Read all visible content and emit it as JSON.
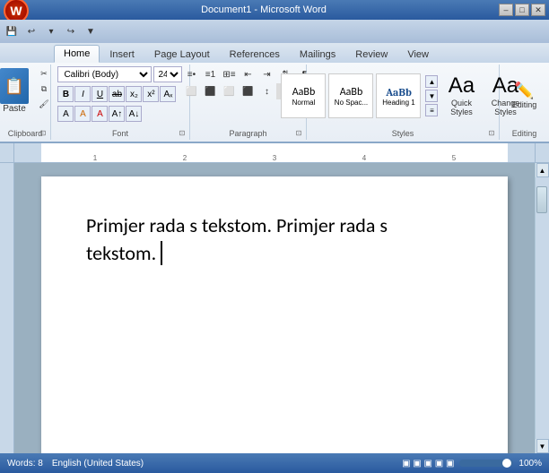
{
  "titlebar": {
    "title": "Document1 - Microsoft Word",
    "minimize": "–",
    "restore": "□",
    "close": "✕"
  },
  "quickaccess": {
    "save": "💾",
    "undo": "↩",
    "redo": "↪",
    "dropdown": "▼"
  },
  "tabs": [
    {
      "id": "home",
      "label": "Home",
      "active": true
    },
    {
      "id": "insert",
      "label": "Insert"
    },
    {
      "id": "pagelayout",
      "label": "Page Layout"
    },
    {
      "id": "references",
      "label": "References"
    },
    {
      "id": "mailings",
      "label": "Mailings"
    },
    {
      "id": "review",
      "label": "Review"
    },
    {
      "id": "view",
      "label": "View"
    }
  ],
  "ribbon": {
    "groups": [
      {
        "id": "clipboard",
        "label": "Clipboard"
      },
      {
        "id": "font",
        "label": "Font"
      },
      {
        "id": "paragraph",
        "label": "Paragraph"
      },
      {
        "id": "styles",
        "label": "Styles"
      },
      {
        "id": "editing",
        "label": "Editing"
      }
    ],
    "font": {
      "name": "Calibri (Body)",
      "size": "24"
    },
    "quickStyles": {
      "label": "Quick\nStyles"
    },
    "changeStyles": {
      "label": "Change\nStyles"
    },
    "editing": {
      "label": "Editing"
    }
  },
  "document": {
    "text_line1": "Primjer rada s tekstom. Primjer rada s",
    "text_line2": "tekstom."
  },
  "statusbar": {
    "words_label": "Words: 8",
    "language": "English (United States)",
    "zoom": "100%",
    "view_icons": [
      "▣",
      "▣",
      "▣",
      "▣",
      "▣"
    ]
  }
}
